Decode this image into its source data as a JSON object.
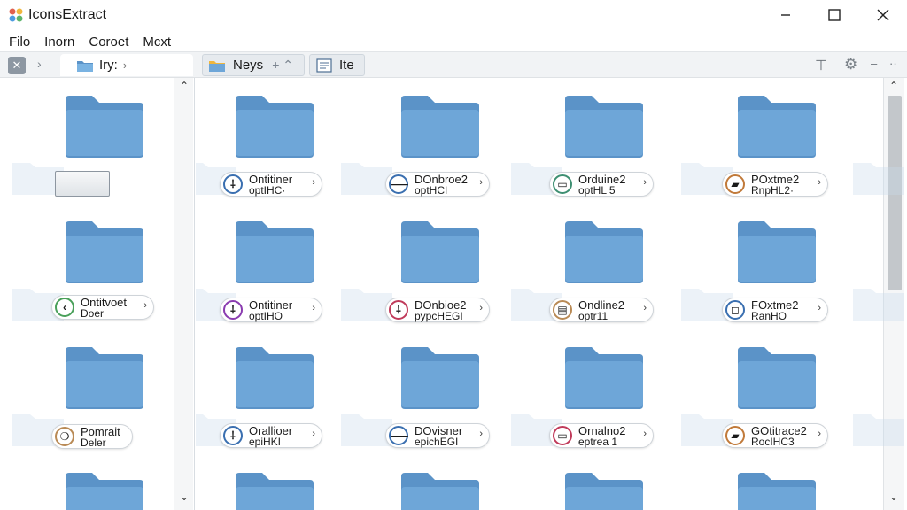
{
  "window": {
    "title": "IconsExtract"
  },
  "menu": [
    "Filo",
    "Inorn",
    "Coroet",
    "Mcxt"
  ],
  "toolbar": {
    "path_label": "Iry:",
    "tab_a_label": "Neys",
    "tab_a_extra": "+ ⌃",
    "tab_b_label": "Ite"
  },
  "left_items": [
    {
      "l1": "Ontitvoet",
      "l2": "Doer",
      "badge_color": "#4aa05a",
      "badge_glyph": "‹"
    },
    {
      "l1": "Pomrait",
      "l2": "Deler",
      "badge_color": "#b98a55",
      "badge_glyph": "❍"
    }
  ],
  "grid_items": [
    {
      "l1": "Ontitiner",
      "l2": "optIHC·",
      "badge_color": "#3a6fb0",
      "badge_glyph": "⸸"
    },
    {
      "l1": "DOnbroe2",
      "l2": "optHCI",
      "badge_color": "#3a6fb0",
      "badge_glyph": "⸺"
    },
    {
      "l1": "Orduine2",
      "l2": "optHL 5",
      "badge_color": "#3e8f72",
      "badge_glyph": "▭"
    },
    {
      "l1": "POxtme2",
      "l2": "RnpHL2·",
      "badge_color": "#c17a3a",
      "badge_glyph": "▰"
    },
    {
      "l1": "Ontitiner",
      "l2": "optIHO",
      "badge_color": "#8a3cb0",
      "badge_glyph": "⸸"
    },
    {
      "l1": "DOnbioe2",
      "l2": "pypcHEGI",
      "badge_color": "#c03a5a",
      "badge_glyph": "⸸"
    },
    {
      "l1": "Ondline2",
      "l2": "optr11",
      "badge_color": "#b98a55",
      "badge_glyph": "▤"
    },
    {
      "l1": "FOxtme2",
      "l2": "RanHO",
      "badge_color": "#3a6fb0",
      "badge_glyph": "◻"
    },
    {
      "l1": "Orallioer",
      "l2": "epiHKI",
      "badge_color": "#3a6fb0",
      "badge_glyph": "⸸"
    },
    {
      "l1": "DOvisner",
      "l2": "epichEGI",
      "badge_color": "#3a6fb0",
      "badge_glyph": "⸺"
    },
    {
      "l1": "Ornalno2",
      "l2": "eptrea 1",
      "badge_color": "#c03a5a",
      "badge_glyph": "▭"
    },
    {
      "l1": "GOtitrace2",
      "l2": "RocIHC3",
      "badge_color": "#c17a3a",
      "badge_glyph": "▰"
    }
  ],
  "colors": {
    "folder_front": "#6ea6d8",
    "folder_back": "#5b93c8",
    "accent": "#3a6fb0"
  }
}
